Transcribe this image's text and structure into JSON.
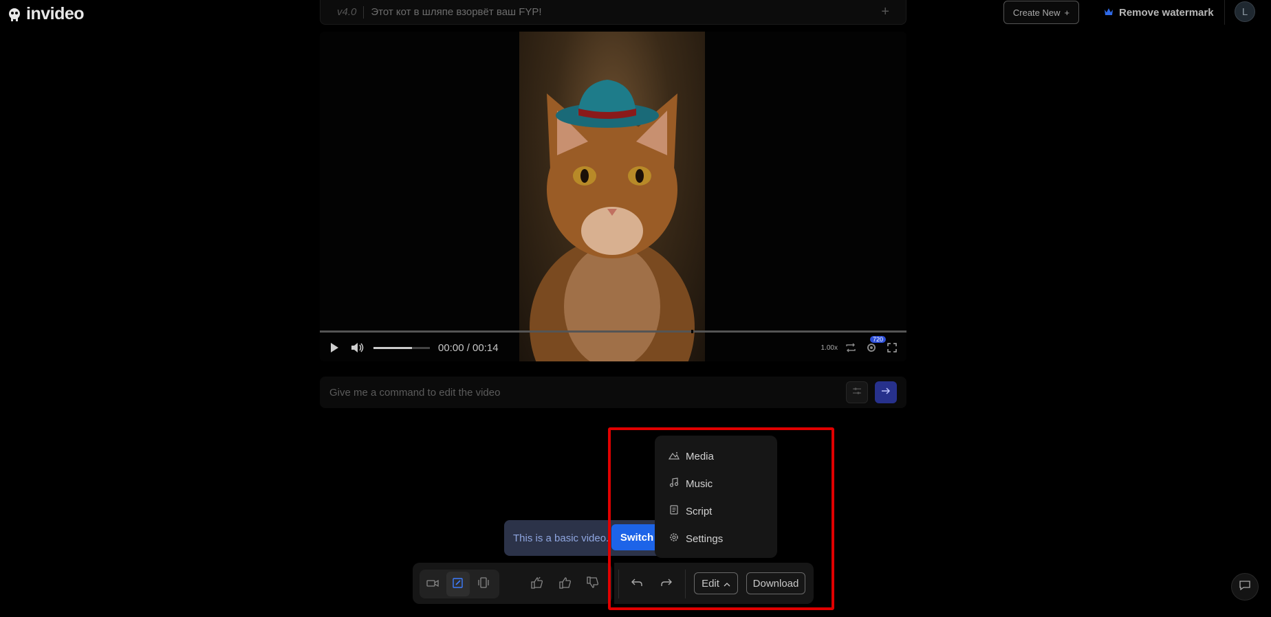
{
  "header": {
    "logo_text": "invideo",
    "version": "v4.0",
    "title": "Этот кот в шляпе взорвёт ваш FYP!",
    "create_new_label": "Create New",
    "remove_watermark_label": "Remove watermark",
    "avatar_initial": "L"
  },
  "player": {
    "time_display": "00:00 / 00:14",
    "speed": "1.00x",
    "quality": "720"
  },
  "command": {
    "placeholder": "Give me a command to edit the video"
  },
  "banner": {
    "text": "This is a basic video.",
    "switch_label": "Switch"
  },
  "toolbar": {
    "edit_label": "Edit",
    "download_label": "Download"
  },
  "edit_menu": {
    "items": [
      {
        "label": "Media",
        "icon": "media-icon"
      },
      {
        "label": "Music",
        "icon": "music-icon"
      },
      {
        "label": "Script",
        "icon": "script-icon"
      },
      {
        "label": "Settings",
        "icon": "gear-icon"
      }
    ]
  },
  "colors": {
    "accent_blue": "#1d64e8",
    "send_button": "#27318c",
    "highlight_red": "#e00000",
    "banner_bg": "#2c3349"
  }
}
